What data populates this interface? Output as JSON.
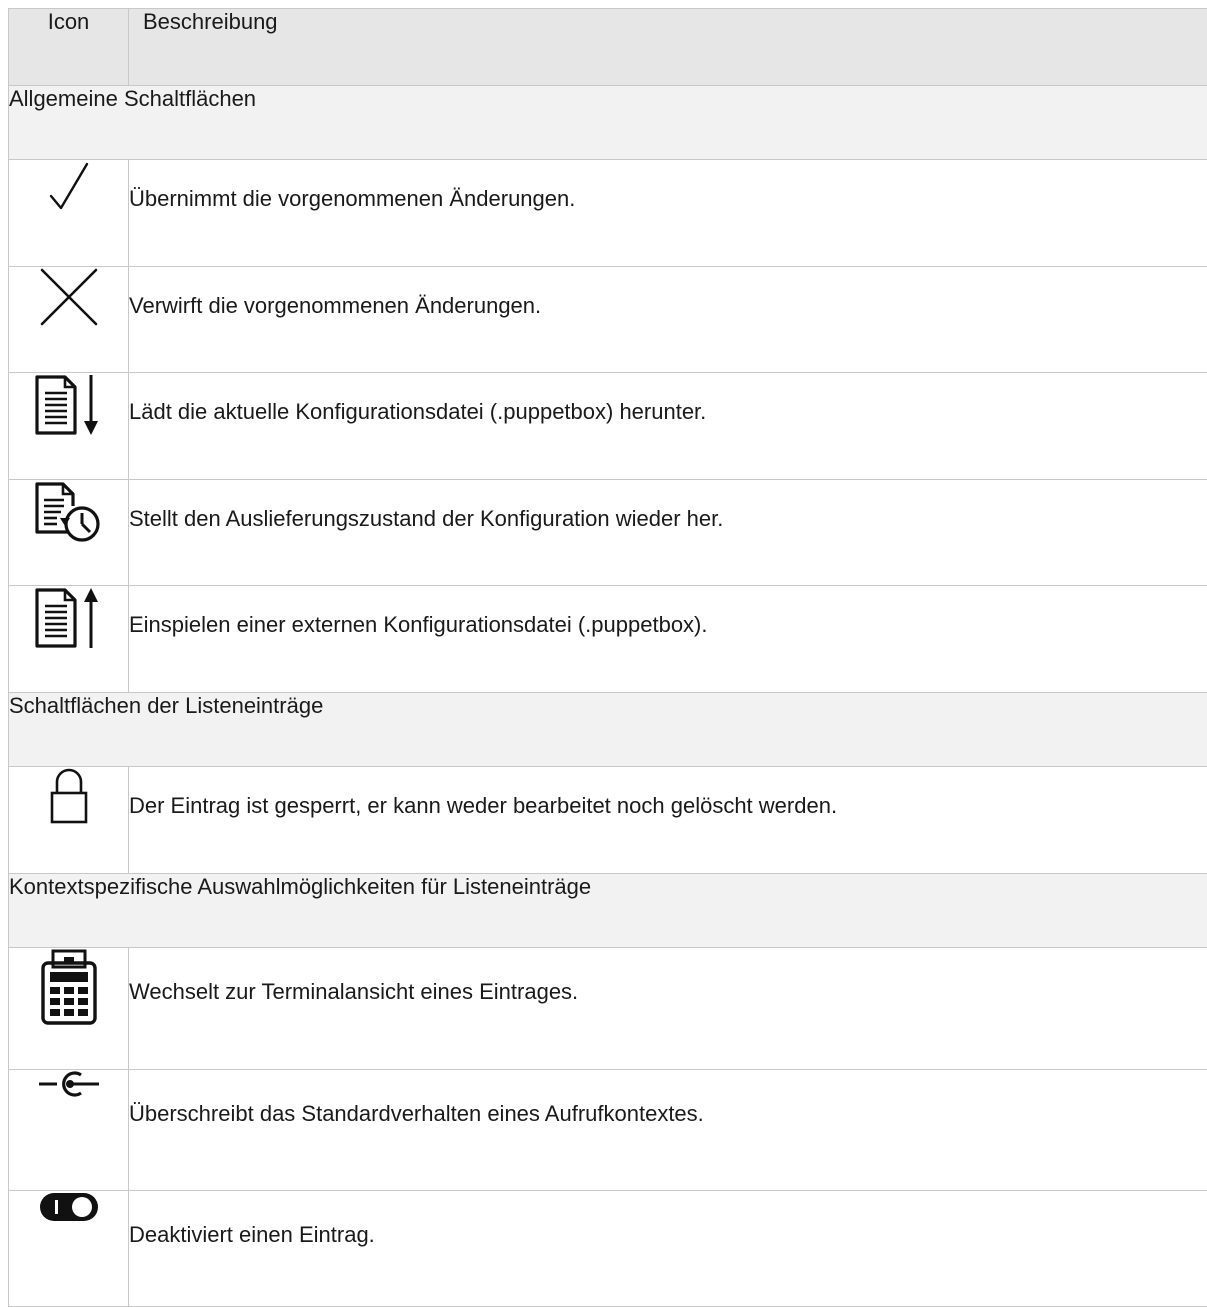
{
  "table": {
    "header": {
      "icon": "Icon",
      "description": "Beschreibung"
    },
    "sections": [
      {
        "title": "Allgemeine Schaltflächen",
        "rows": [
          {
            "icon": "checkmark-icon",
            "description": "Übernimmt die vorgenommenen  Änderungen."
          },
          {
            "icon": "close-icon",
            "description": "Verwirft die vorgenommenen  Änderungen."
          },
          {
            "icon": "document-download-icon",
            "description": "Lädt die aktuelle Konfigurationsdatei (.puppetbox) herunter."
          },
          {
            "icon": "document-restore-clock-icon",
            "description": "Stellt den Auslieferungszustand der Konfiguration wieder her."
          },
          {
            "icon": "document-upload-icon",
            "description": "Einspielen einer externen Konfigurationsdatei (.puppetbox)."
          }
        ]
      },
      {
        "title": "Schaltflächen der Listeneinträge",
        "rows": [
          {
            "icon": "lock-icon",
            "description": "Der Eintrag ist gesperrt, er kann weder bearbeitet noch gelöscht werden."
          }
        ]
      },
      {
        "title": "Kontextspezifische Auswahlmöglichkeiten für Listeneinträge",
        "rows": [
          {
            "icon": "terminal-icon",
            "description": "Wechselt zur Terminalansicht eines Eintrages."
          },
          {
            "icon": "override-context-icon",
            "description": "Überschreibt das Standardverhalten eines Aufrufkontextes."
          },
          {
            "icon": "toggle-icon",
            "description": "Deaktiviert einen Eintrag."
          }
        ]
      }
    ]
  }
}
